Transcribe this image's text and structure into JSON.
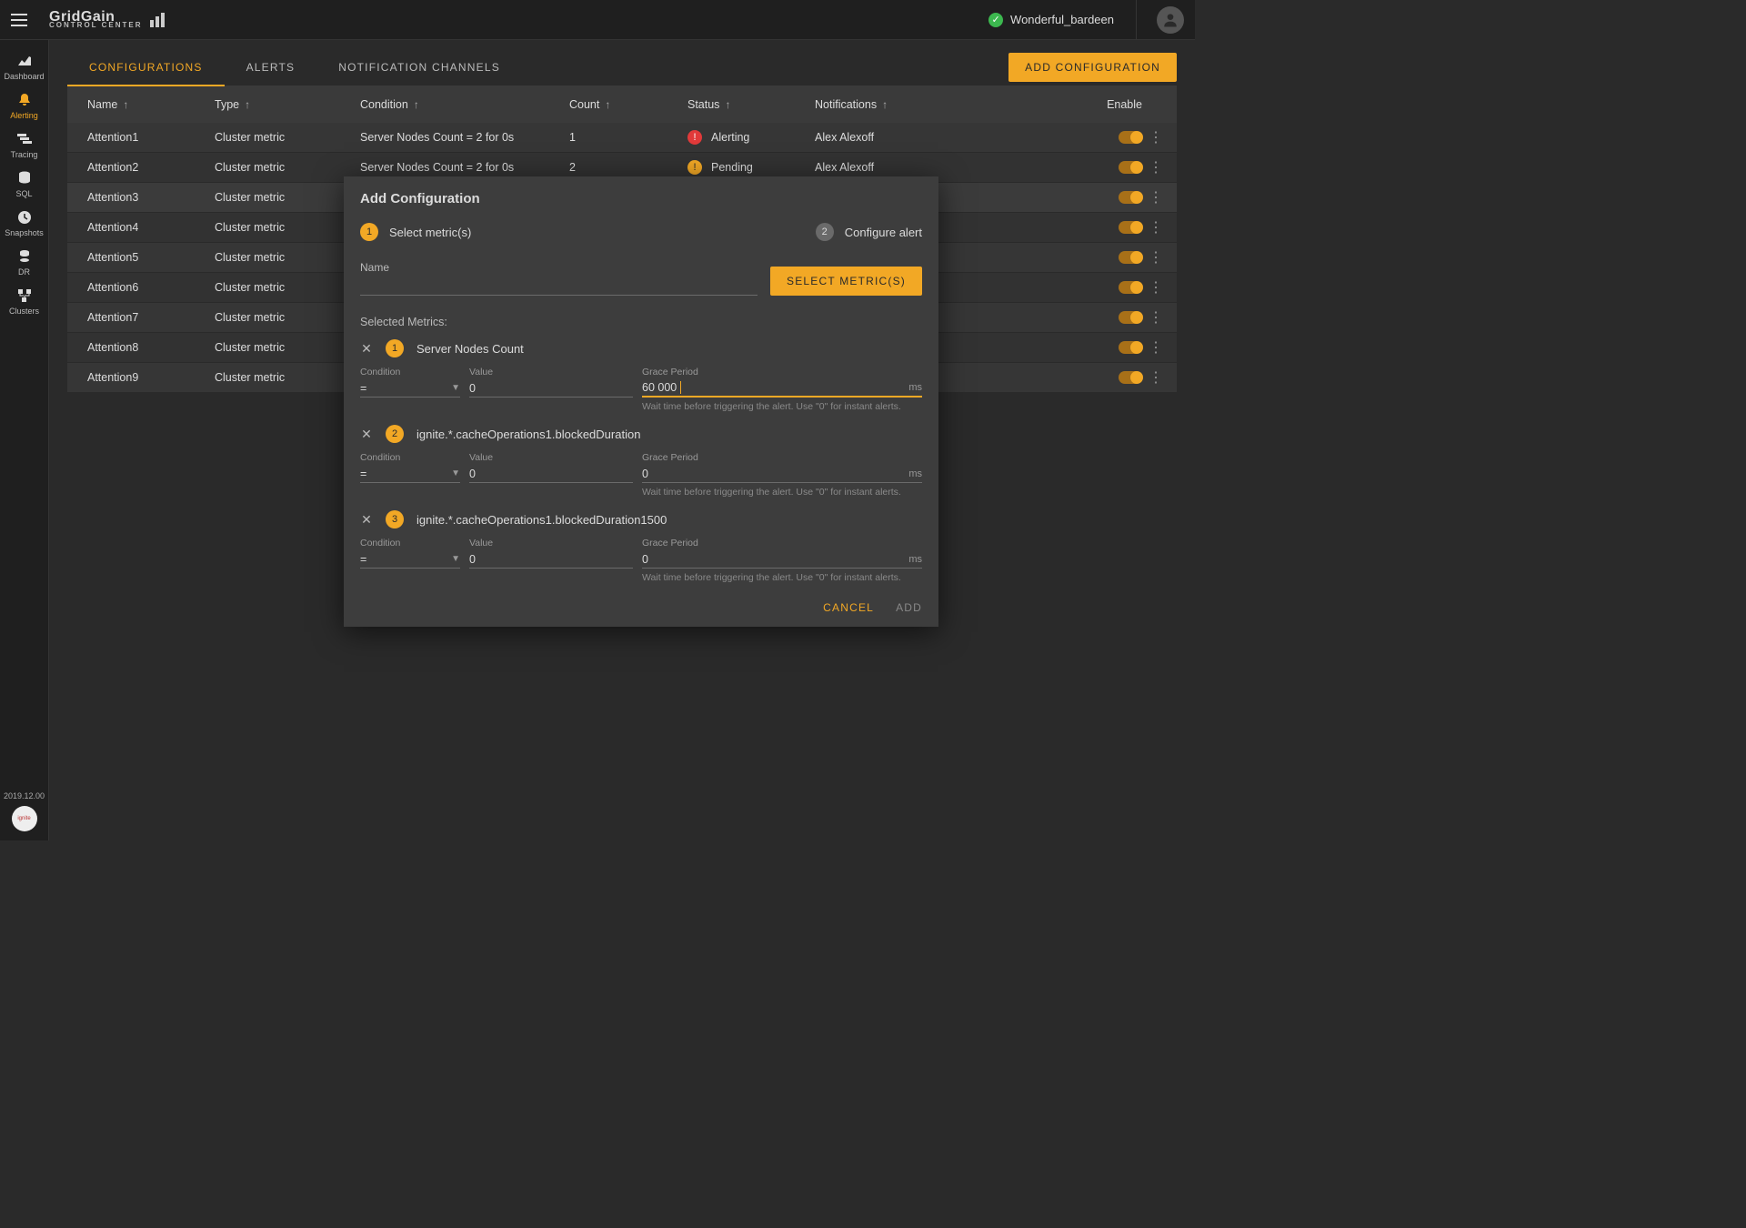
{
  "topbar": {
    "brand": "GridGain",
    "brand_sub": "CONTROL CENTER",
    "cluster_name": "Wonderful_bardeen"
  },
  "sidebar": {
    "items": [
      {
        "label": "Dashboard"
      },
      {
        "label": "Alerting"
      },
      {
        "label": "Tracing"
      },
      {
        "label": "SQL"
      },
      {
        "label": "Snapshots"
      },
      {
        "label": "DR"
      },
      {
        "label": "Clusters"
      }
    ],
    "version": "2019.12.00"
  },
  "tabs": {
    "configurations": "CONFIGURATIONS",
    "alerts": "ALERTS",
    "channels": "NOTIFICATION CHANNELS",
    "add_btn": "ADD CONFIGURATION"
  },
  "table": {
    "headers": {
      "name": "Name",
      "type": "Type",
      "condition": "Condition",
      "count": "Count",
      "status": "Status",
      "notifications": "Notifications",
      "enable": "Enable"
    },
    "rows": [
      {
        "name": "Attention1",
        "type": "Cluster metric",
        "condition": "Server Nodes Count = 2 for 0s",
        "count": "1",
        "status": "Alerting",
        "status_kind": "alerting",
        "notifications": "Alex Alexoff"
      },
      {
        "name": "Attention2",
        "type": "Cluster metric",
        "condition": "Server Nodes Count = 2 for 0s",
        "count": "2",
        "status": "Pending",
        "status_kind": "pending",
        "notifications": "Alex Alexoff"
      },
      {
        "name": "Attention3",
        "type": "Cluster metric",
        "condition": "",
        "count": "",
        "status": "",
        "status_kind": "",
        "notifications": ""
      },
      {
        "name": "Attention4",
        "type": "Cluster metric",
        "condition": "",
        "count": "",
        "status": "",
        "status_kind": "",
        "notifications": ""
      },
      {
        "name": "Attention5",
        "type": "Cluster metric",
        "condition": "",
        "count": "",
        "status": "",
        "status_kind": "",
        "notifications": ""
      },
      {
        "name": "Attention6",
        "type": "Cluster metric",
        "condition": "",
        "count": "",
        "status": "",
        "status_kind": "",
        "notifications": ""
      },
      {
        "name": "Attention7",
        "type": "Cluster metric",
        "condition": "",
        "count": "",
        "status": "",
        "status_kind": "",
        "notifications": ""
      },
      {
        "name": "Attention8",
        "type": "Cluster metric",
        "condition": "",
        "count": "",
        "status": "",
        "status_kind": "",
        "notifications": ""
      },
      {
        "name": "Attention9",
        "type": "Cluster metric",
        "condition": "",
        "count": "",
        "status": "",
        "status_kind": "",
        "notifications": ""
      }
    ]
  },
  "modal": {
    "title": "Add Configuration",
    "step1": "Select metric(s)",
    "step2": "Configure alert",
    "name_label": "Name",
    "select_btn": "SELECT METRIC(S)",
    "selected_label": "Selected Metrics:",
    "labels": {
      "condition": "Condition",
      "value": "Value",
      "grace": "Grace Period",
      "unit": "ms"
    },
    "help": "Wait time before triggering the alert. Use \"0\" for instant alerts.",
    "metrics": [
      {
        "name": "Server Nodes Count",
        "condition": "=",
        "value": "0",
        "grace": "60 000",
        "focused": true
      },
      {
        "name": "ignite.*.cacheOperations1.blockedDuration",
        "condition": "=",
        "value": "0",
        "grace": "0",
        "focused": false
      },
      {
        "name": "ignite.*.cacheOperations1.blockedDuration1500",
        "condition": "=",
        "value": "0",
        "grace": "0",
        "focused": false
      }
    ],
    "cancel": "CANCEL",
    "add": "ADD"
  }
}
